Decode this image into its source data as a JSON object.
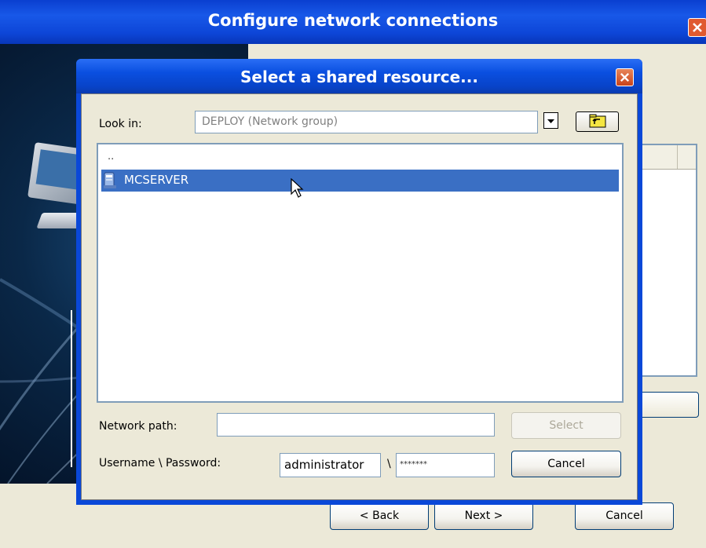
{
  "window": {
    "title": "Configure network connections",
    "close_icon": "close-icon"
  },
  "wizard": {
    "back_label": "< Back",
    "next_label": "Next >",
    "cancel_label": "Cancel"
  },
  "dialog": {
    "title": "Select a shared resource...",
    "close_icon": "close-icon",
    "look_in_label": "Look in:",
    "look_in_value": "DEPLOY (Network group)",
    "dropdown_icon": "chevron-down-icon",
    "up_folder_icon": "folder-up-icon",
    "file_list": {
      "parent_item": "..",
      "items": [
        {
          "label": "MCSERVER",
          "icon": "server-icon",
          "selected": true
        }
      ]
    },
    "network_path_label": "Network path:",
    "network_path_value": "",
    "select_label": "Select",
    "credentials_label": "Username \\ Password:",
    "username_value": "administrator",
    "separator": "\\",
    "password_value": "*******",
    "cancel_label": "Cancel"
  },
  "colors": {
    "titlebar": "#0a48d8",
    "selection": "#3a6fc4",
    "close_button": "#e05a30",
    "face": "#ece9d8"
  }
}
